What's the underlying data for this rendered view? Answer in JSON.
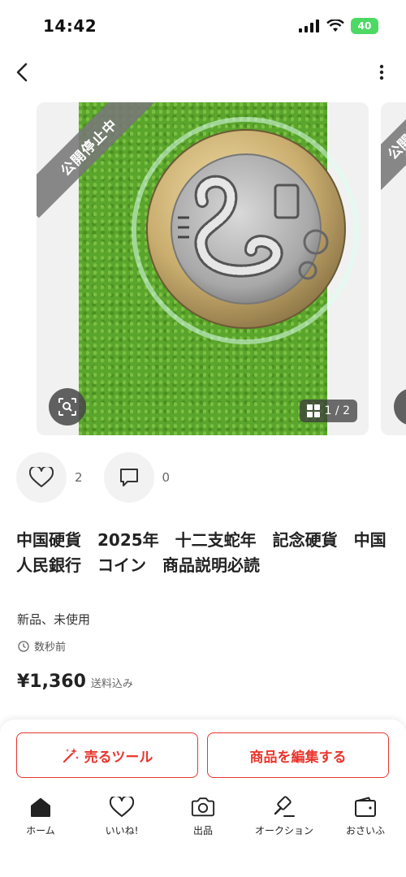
{
  "status_bar": {
    "time": "14:42",
    "battery": "40"
  },
  "carousel": {
    "badge": "公開停止中",
    "counter": "1 / 2"
  },
  "actions": {
    "likes": "2",
    "comments": "0"
  },
  "product": {
    "title": "中国硬貨　2025年　十二支蛇年　記念硬貨　中国人民銀行　コイン　商品説明必読",
    "condition": "新品、未使用",
    "posted": "数秒前",
    "price": "¥1,360",
    "price_note": "送料込み"
  },
  "buttons": {
    "sell_tool": "売るツール",
    "edit": "商品を編集する"
  },
  "tabbar": [
    {
      "label": "ホーム",
      "icon": "home-icon"
    },
    {
      "label": "いいね!",
      "icon": "heart-icon"
    },
    {
      "label": "出品",
      "icon": "camera-icon"
    },
    {
      "label": "オークション",
      "icon": "gavel-icon"
    },
    {
      "label": "おさいふ",
      "icon": "wallet-icon"
    }
  ],
  "colors": {
    "accent": "#ea352d",
    "battery": "#4cd964"
  }
}
